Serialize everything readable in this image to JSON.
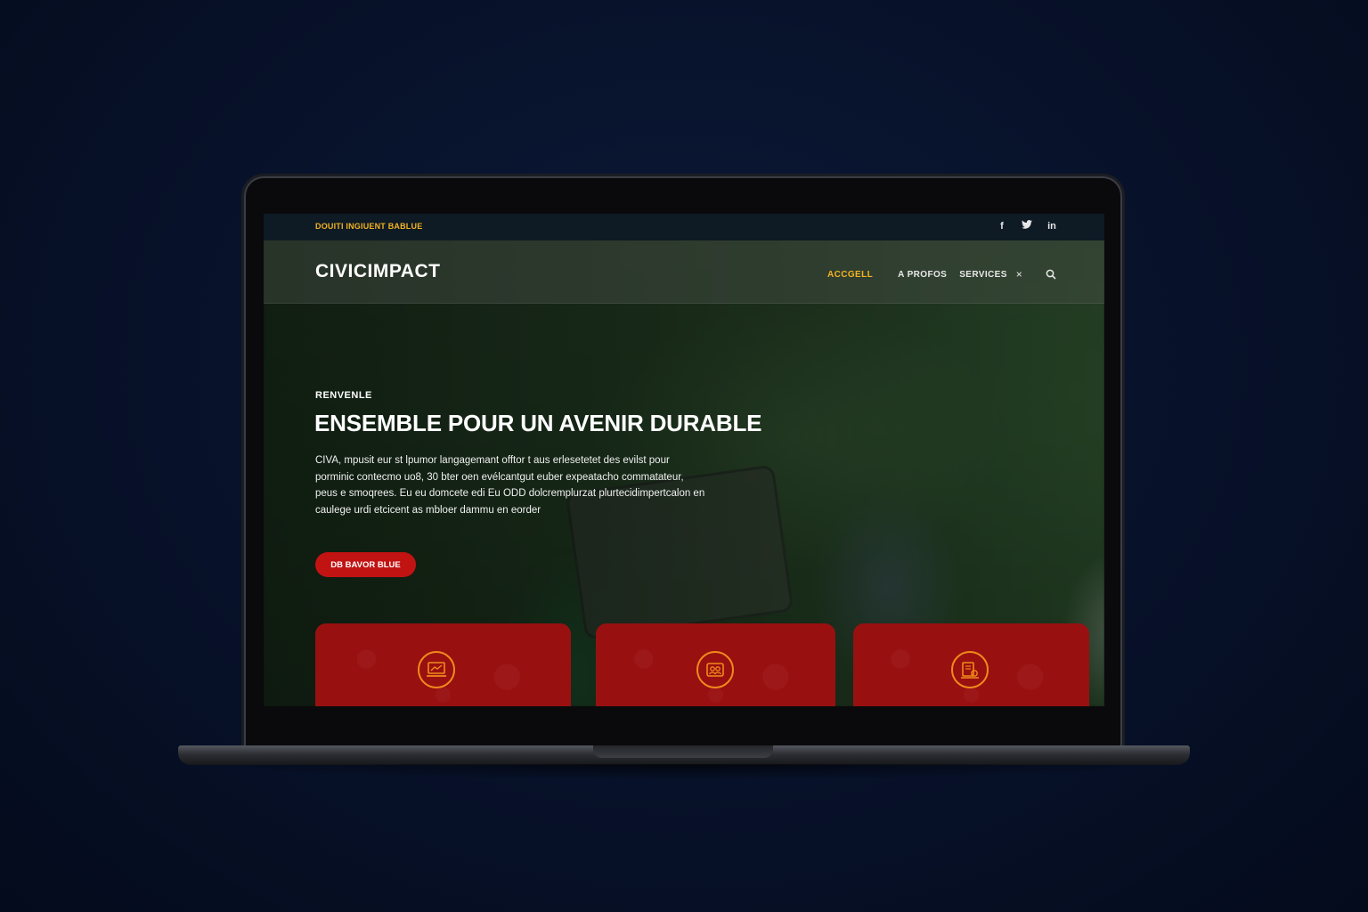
{
  "topbar": {
    "text": "DOUITI INGIUENT BABLUE",
    "socials": [
      {
        "icon": "facebook-icon",
        "glyph": "f"
      },
      {
        "icon": "twitter-icon",
        "glyph": "🐦"
      },
      {
        "icon": "linkedin-icon",
        "glyph": "in"
      }
    ]
  },
  "nav": {
    "brand": "CIVICIMPACT",
    "items": [
      {
        "label": "ACCGELL",
        "active": true
      },
      {
        "label": "A PROFOS",
        "active": false
      },
      {
        "label": "SERVICES",
        "active": false
      }
    ],
    "close_glyph": "×"
  },
  "hero": {
    "eyebrow": "RENVENLE",
    "headline": "ENSEMBLE POUR UN AVENIR DURABLE",
    "body": "CIVA, mpusit eur st lpumor langagemant offtor t aus erlesetetet des evilst pour porminic contecmo uo8, 30 bter oen evélcantgut euber expeatacho commatateur, peus e smoqrees. Eu eu domcete edi Eu ODD dolcremplurzat plurtecidimpertcalon en caulege urdi etcicent as mbloer dammu en eorder",
    "cta_label": "DB BAVOR BLUE"
  },
  "colors": {
    "accent_yellow": "#f2b321",
    "cta_red": "#c21313",
    "card_red": "#991010",
    "icon_orange": "#f08a1c"
  },
  "cards": [
    {
      "icon": "laptop-chart-icon"
    },
    {
      "icon": "community-icon"
    },
    {
      "icon": "document-gear-icon"
    }
  ]
}
